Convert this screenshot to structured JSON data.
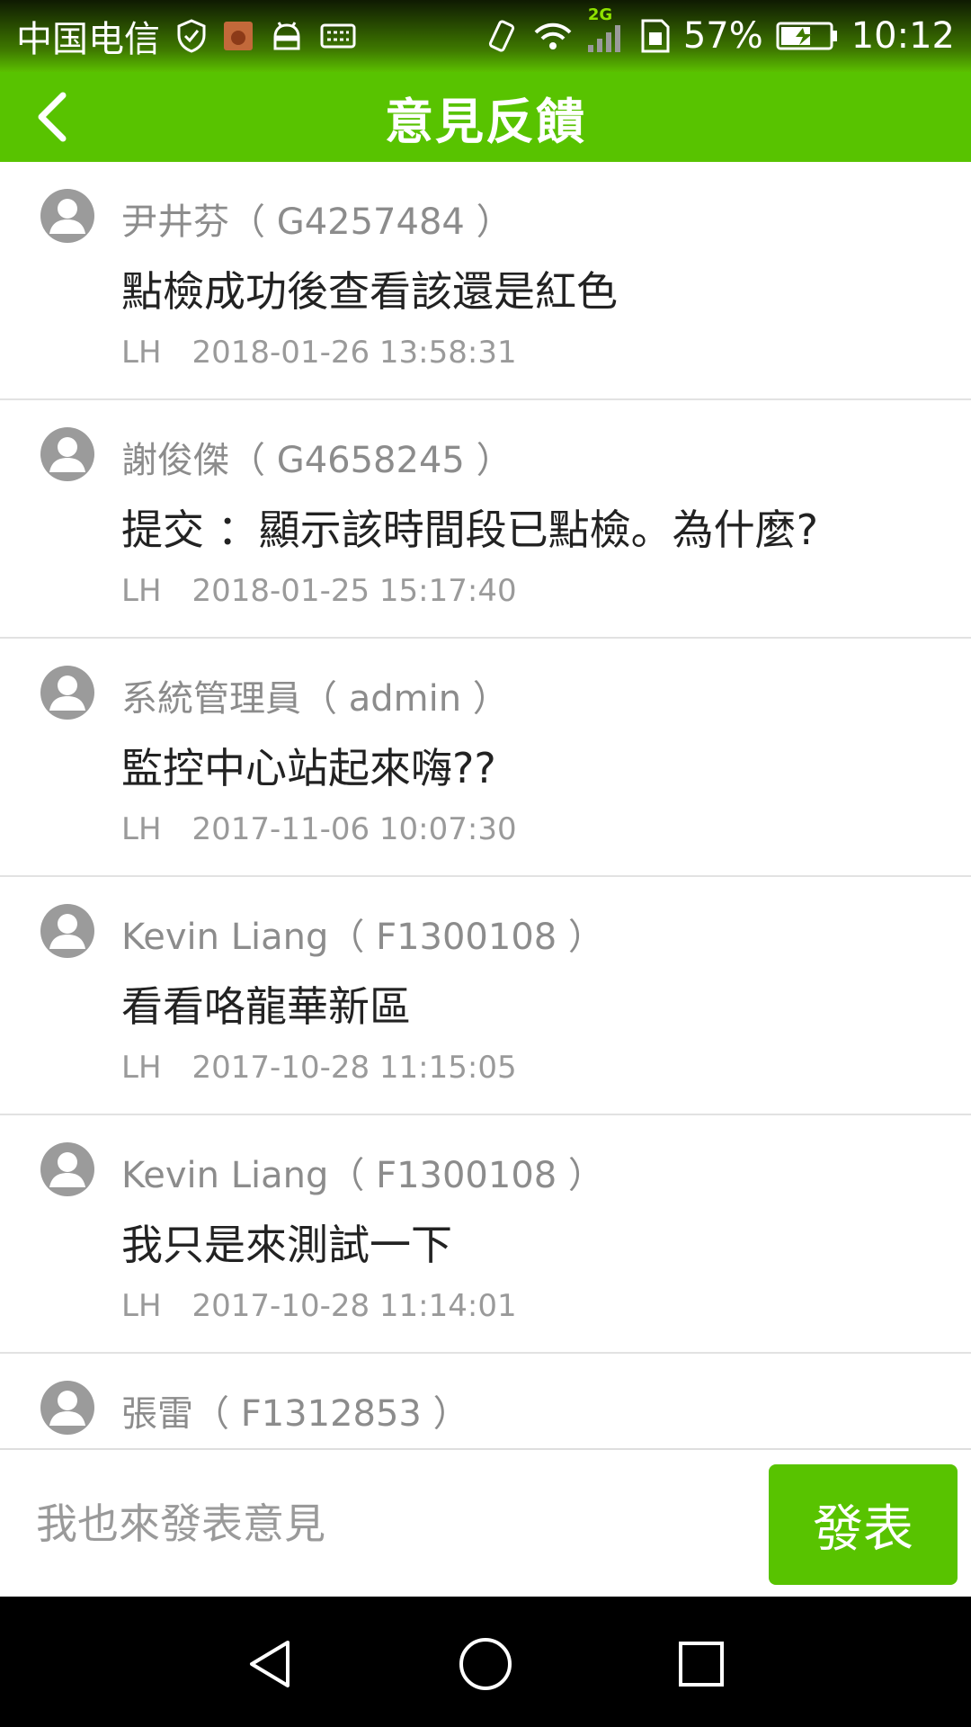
{
  "status_bar": {
    "carrier": "中国电信",
    "network_label": "2G",
    "battery_percent": "57%",
    "time": "10:12",
    "icons": [
      "shield-check-icon",
      "notification-app-icon",
      "android-icon",
      "keyboard-icon",
      "vibrate-icon",
      "wifi-icon",
      "signal-icon",
      "sim-icon",
      "battery-charging-icon"
    ]
  },
  "app_bar": {
    "title": "意見反饋",
    "back_icon": "chevron-left-icon"
  },
  "colors": {
    "brand_green": "#58c300",
    "text_primary": "#222222",
    "text_secondary": "#8c8c8c"
  },
  "feedback": [
    {
      "author": "尹井芬（ G4257484 ）",
      "message": "點檢成功後查看該還是紅色",
      "source": "LH",
      "timestamp": "2018-01-26 13:58:31"
    },
    {
      "author": "謝俊傑（ G4658245 ）",
      "message": "提交 ：顯示該時間段已點檢。為什麼?",
      "source": "LH",
      "timestamp": "2018-01-25 15:17:40"
    },
    {
      "author": "系統管理員（ admin ）",
      "message": "監控中心站起來嗨??",
      "source": "LH",
      "timestamp": "2017-11-06 10:07:30"
    },
    {
      "author": "Kevin Liang（ F1300108 ）",
      "message": "看看咯龍華新區",
      "source": "LH",
      "timestamp": "2017-10-28 11:15:05"
    },
    {
      "author": "Kevin Liang（ F1300108 ）",
      "message": "我只是來測試一下",
      "source": "LH",
      "timestamp": "2017-10-28 11:14:01"
    },
    {
      "author": "張雷（ F1312853 ）",
      "message": "",
      "source": "",
      "timestamp": ""
    }
  ],
  "composer": {
    "placeholder": "我也來發表意見",
    "value": "",
    "submit_label": "發表"
  },
  "nav_bar": {
    "icons": [
      "nav-back-icon",
      "nav-home-icon",
      "nav-recents-icon"
    ]
  }
}
